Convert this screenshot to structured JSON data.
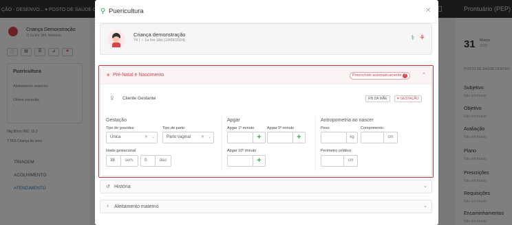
{
  "background": {
    "topbar": {
      "breadcrumb": "ÇÃO - DESENVO... ▾  POSTO DE SAÚDE CE",
      "right_tag": "ERTAS"
    },
    "patient": {
      "name": "Criança Demonstração",
      "sub": "7| 1a 6m 18d, feminino"
    },
    "left_panel": {
      "title": "Puericultura",
      "items": [
        "Aleitamento materno",
        "-",
        "Última consulta",
        "-"
      ],
      "meta_row": "0kg  80cm  IMC: 15,2",
      "tag_row": "T.TES  Criança do sexo",
      "nav": [
        "TRIAGEM",
        "ACOLHIMENTO",
        "ATENDIMENTO"
      ]
    },
    "right_panel": {
      "header": "Prontuário (PEP)",
      "date_day": "31",
      "date_month": "Março",
      "date_year": "2025",
      "unit": "POSTO DE SAÚDE CENTRO",
      "sections": [
        {
          "title": "Subjetivo",
          "sub": "Não informado"
        },
        {
          "title": "Objetivo",
          "sub": "Não informado"
        },
        {
          "title": "Avaliação",
          "sub": "Não informado"
        },
        {
          "title": "Plano",
          "sub": "Não informado"
        },
        {
          "title": "Prescrições",
          "sub": "Não informado"
        },
        {
          "title": "Requisições",
          "sub": "Não informado"
        },
        {
          "title": "Encaminhamentos",
          "sub": "Não informado"
        }
      ]
    }
  },
  "modal": {
    "title": "Puericultura",
    "patient_card": {
      "name": "Criança demonstração",
      "sub": "74 | ♀ 1a 6m 18d (13/09/2024)"
    },
    "prenatal": {
      "title": "Pré-Natal e Nascimento",
      "badge": "Preenchido automaticamente",
      "gestante_label": "Cliente Gestante",
      "chip_mae": "RN DA MÃE",
      "chip_gestacao": "♥ GESTAÇÃO",
      "gestacao": {
        "heading": "Gestação",
        "tipo_gravidez_label": "Tipo de gravidez",
        "tipo_gravidez_value": "Única",
        "tipo_parto_label": "Tipo de parto",
        "tipo_parto_value": "Parto vaginal",
        "idade_label": "Idade gestacional",
        "idade_sem_value": "38",
        "sem_unit": "sem.",
        "idade_dias_value": "0",
        "dias_unit": "dias"
      },
      "apgar": {
        "heading": "Apgar",
        "min1_label": "Apgar 1º minuto",
        "min5_label": "Apgar 5º minuto",
        "min10_label": "Apgar 10º minuto"
      },
      "antropometria": {
        "heading": "Antropometria ao nascer",
        "peso_label": "Peso",
        "peso_unit": "kg",
        "comprimento_label": "Comprimento",
        "comprimento_unit": "cm",
        "perimetro_label": "Perímetro cefálico",
        "perimetro_unit": "cm"
      }
    },
    "historia": {
      "title": "História"
    },
    "aleitamento": {
      "title": "Aleitamento materno"
    }
  },
  "colors": {
    "accent_green": "#3aa55f",
    "accent_red": "#d9434a",
    "highlight_border": "#d62a32"
  }
}
